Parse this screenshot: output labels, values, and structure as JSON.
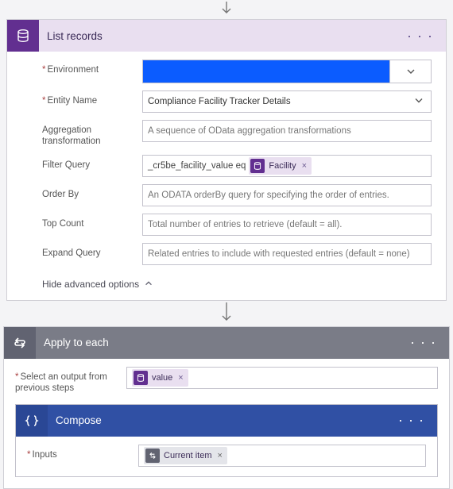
{
  "list_records": {
    "title": "List records",
    "fields": {
      "environment": {
        "label": "Environment"
      },
      "entity_name": {
        "label": "Entity Name",
        "value": "Compliance Facility Tracker Details"
      },
      "aggregation": {
        "label": "Aggregation transformation",
        "placeholder": "A sequence of OData aggregation transformations"
      },
      "filter_query": {
        "label": "Filter Query",
        "prefix": "_cr5be_facility_value eq",
        "token": "Facility"
      },
      "order_by": {
        "label": "Order By",
        "placeholder": "An ODATA orderBy query for specifying the order of entries."
      },
      "top_count": {
        "label": "Top Count",
        "placeholder": "Total number of entries to retrieve (default = all)."
      },
      "expand_query": {
        "label": "Expand Query",
        "placeholder": "Related entries to include with requested entries (default = none)"
      }
    },
    "hide_advanced": "Hide advanced options"
  },
  "apply_to_each": {
    "title": "Apply to each",
    "select_output_label": "Select an output from previous steps",
    "token": "value"
  },
  "compose": {
    "title": "Compose",
    "inputs_label": "Inputs",
    "token": "Current item"
  }
}
